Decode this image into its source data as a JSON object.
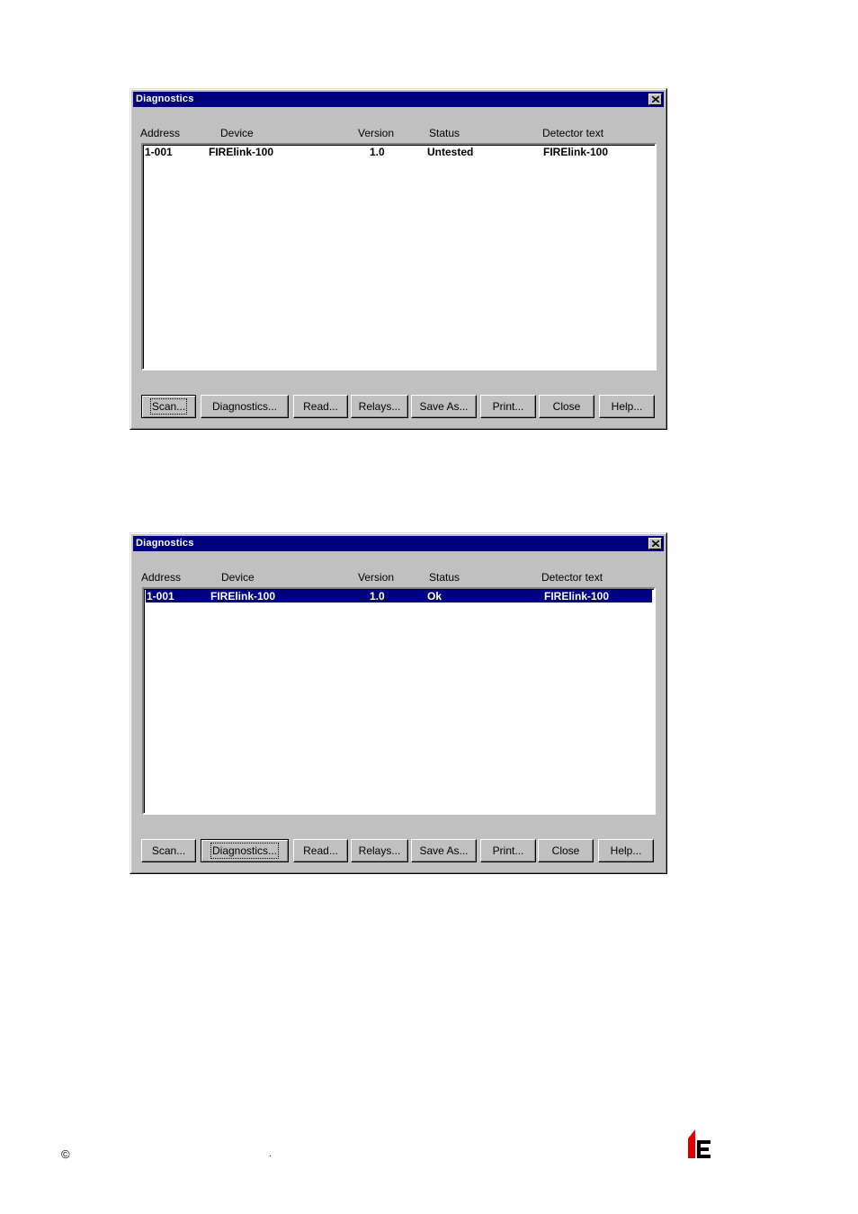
{
  "dialogs": [
    {
      "title": "Diagnostics",
      "columns": [
        "Address",
        "Device",
        "Version",
        "Status",
        "Detector text"
      ],
      "rows": [
        {
          "address": "1-001",
          "device": "FIRElink-100",
          "version": "1.0",
          "status": "Untested",
          "detector_text": "FIRElink-100",
          "selected": false
        }
      ],
      "buttons": [
        "Scan...",
        "Diagnostics...",
        "Read...",
        "Relays...",
        "Save As...",
        "Print...",
        "Close",
        "Help..."
      ],
      "focused_button": "Scan..."
    },
    {
      "title": "Diagnostics",
      "columns": [
        "Address",
        "Device",
        "Version",
        "Status",
        "Detector text"
      ],
      "rows": [
        {
          "address": "1-001",
          "device": "FIRElink-100",
          "version": "1.0",
          "status": "Ok",
          "detector_text": "FIRElink-100",
          "selected": true
        }
      ],
      "buttons": [
        "Scan...",
        "Diagnostics...",
        "Read...",
        "Relays...",
        "Save As...",
        "Print...",
        "Close",
        "Help..."
      ],
      "focused_button": "Diagnostics..."
    }
  ],
  "footer": {
    "copyright": "©",
    "dot": "."
  },
  "icons": {
    "title_close": "close-icon",
    "logo": "company-logo-icon"
  },
  "colors": {
    "titlebar": "#000080",
    "dialog_bg": "#c0c0c0",
    "selection": "#000080",
    "logo_red": "#e00000"
  }
}
